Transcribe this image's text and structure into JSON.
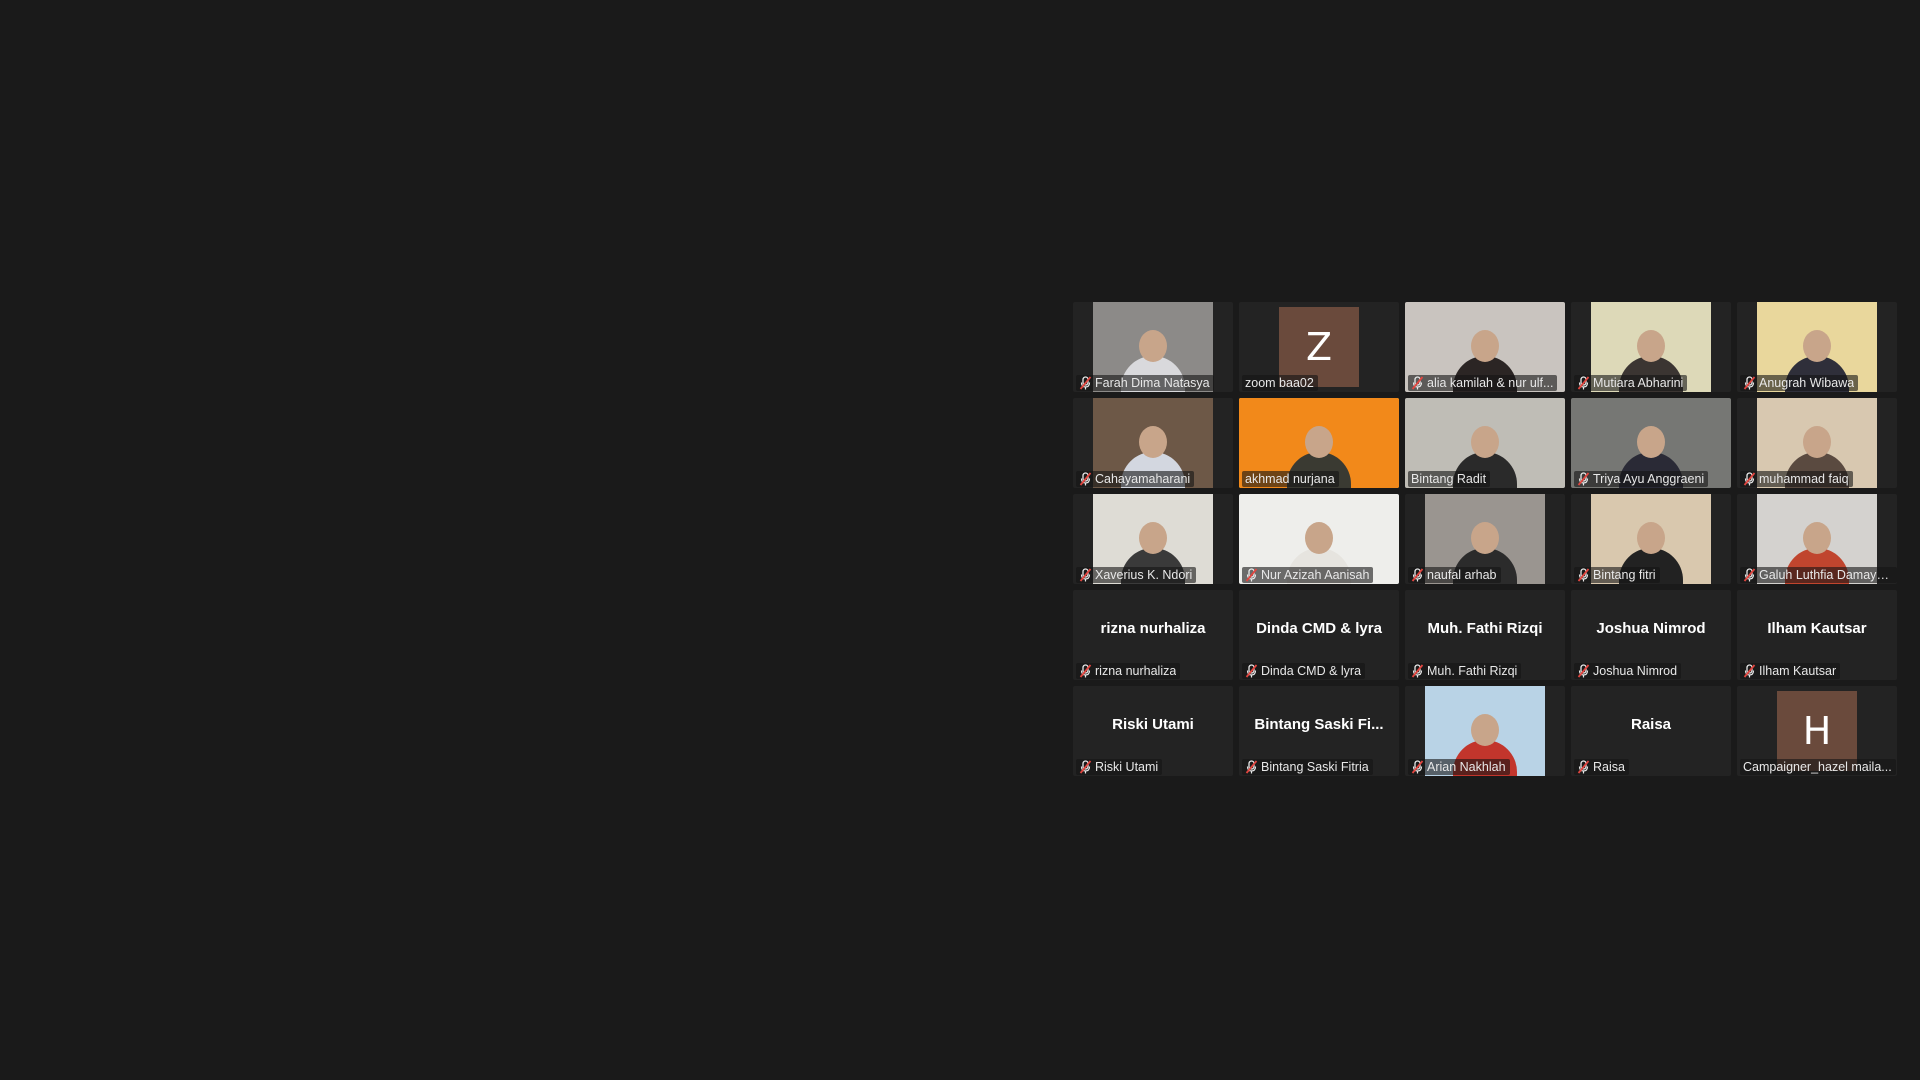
{
  "meeting": {
    "participants": [
      {
        "name": "Farah Dima Natasya",
        "muted": true,
        "kind": "video",
        "bg": "#8c8a88",
        "person": "#d9d9dc"
      },
      {
        "name": "zoom baa02",
        "muted": false,
        "kind": "avatar",
        "initial": "Z"
      },
      {
        "name": "alia kamilah & nur ulf...",
        "muted": true,
        "kind": "video",
        "bg": "#c9c4bf",
        "person": "#2b2524",
        "wide": true
      },
      {
        "name": "Mutiara Abharini",
        "muted": true,
        "kind": "video",
        "bg": "#ddd9b8",
        "person": "#3b3532"
      },
      {
        "name": "Anugrah Wibawa",
        "muted": true,
        "kind": "video",
        "bg": "#e9d79c",
        "person": "#2f2f3a"
      },
      {
        "name": "Cahayamaharani",
        "muted": true,
        "kind": "video",
        "bg": "#6d5847",
        "person": "#d3d7e0"
      },
      {
        "name": "akhmad nurjana",
        "muted": false,
        "kind": "video",
        "bg": "#f2891a",
        "person": "#3a3a32",
        "wide": true,
        "active": true
      },
      {
        "name": "Bintang Radit",
        "muted": false,
        "kind": "video",
        "bg": "#bfbdb6",
        "person": "#2a2a2a",
        "wide": true
      },
      {
        "name": "Triya Ayu Anggraeni",
        "muted": true,
        "kind": "video",
        "bg": "#767774",
        "person": "#2a2a36",
        "wide": true
      },
      {
        "name": "muhammad faiq",
        "muted": true,
        "kind": "video",
        "bg": "#d8c8b0",
        "person": "#5a4a40"
      },
      {
        "name": "Xaverius K. Ndori",
        "muted": true,
        "kind": "video",
        "bg": "#dedcd5",
        "person": "#3a3a3a"
      },
      {
        "name": "Nur Azizah Aanisah",
        "muted": true,
        "kind": "video",
        "bg": "#eeeeeb",
        "person": "#e6e4df",
        "wide": true
      },
      {
        "name": "naufal arhab",
        "muted": true,
        "kind": "video",
        "bg": "#9a9590",
        "person": "#2b2b2b"
      },
      {
        "name": "Bintang fitri",
        "muted": true,
        "kind": "video",
        "bg": "#d9c8ae",
        "person": "#222"
      },
      {
        "name": "Galuh Luthfia Damaya...",
        "muted": true,
        "kind": "video",
        "bg": "#d4d2cf",
        "person": "#c0452e"
      },
      {
        "name": "rizna nurhaliza",
        "muted": true,
        "kind": "name",
        "display": "rizna nurhaliza"
      },
      {
        "name": "Dinda CMD & lyra",
        "muted": true,
        "kind": "name",
        "display": "Dinda CMD & lyra"
      },
      {
        "name": "Muh. Fathi Rizqi",
        "muted": true,
        "kind": "name",
        "display": "Muh. Fathi Rizqi"
      },
      {
        "name": "Joshua Nimrod",
        "muted": true,
        "kind": "name",
        "display": "Joshua Nimrod"
      },
      {
        "name": "Ilham Kautsar",
        "muted": true,
        "kind": "name",
        "display": "Ilham Kautsar"
      },
      {
        "name": "Riski Utami",
        "muted": true,
        "kind": "name",
        "display": "Riski Utami"
      },
      {
        "name": "Bintang Saski Fitria",
        "muted": true,
        "kind": "name",
        "display": "Bintang Saski Fi..."
      },
      {
        "name": "Arian Nakhlah",
        "muted": true,
        "kind": "video",
        "bg": "#b9d3e6",
        "person": "#c2352c"
      },
      {
        "name": "Raisa",
        "muted": true,
        "kind": "name",
        "display": "Raisa"
      },
      {
        "name": "Campaigner_hazel maila...",
        "muted": false,
        "kind": "avatar",
        "initial": "H"
      }
    ]
  },
  "colors": {
    "background": "#1a1a1a",
    "tile": "#232323",
    "active_speaker_border": "#e6d94a",
    "mute_icon": "#e0453f",
    "avatar": "#6a4a3c"
  }
}
